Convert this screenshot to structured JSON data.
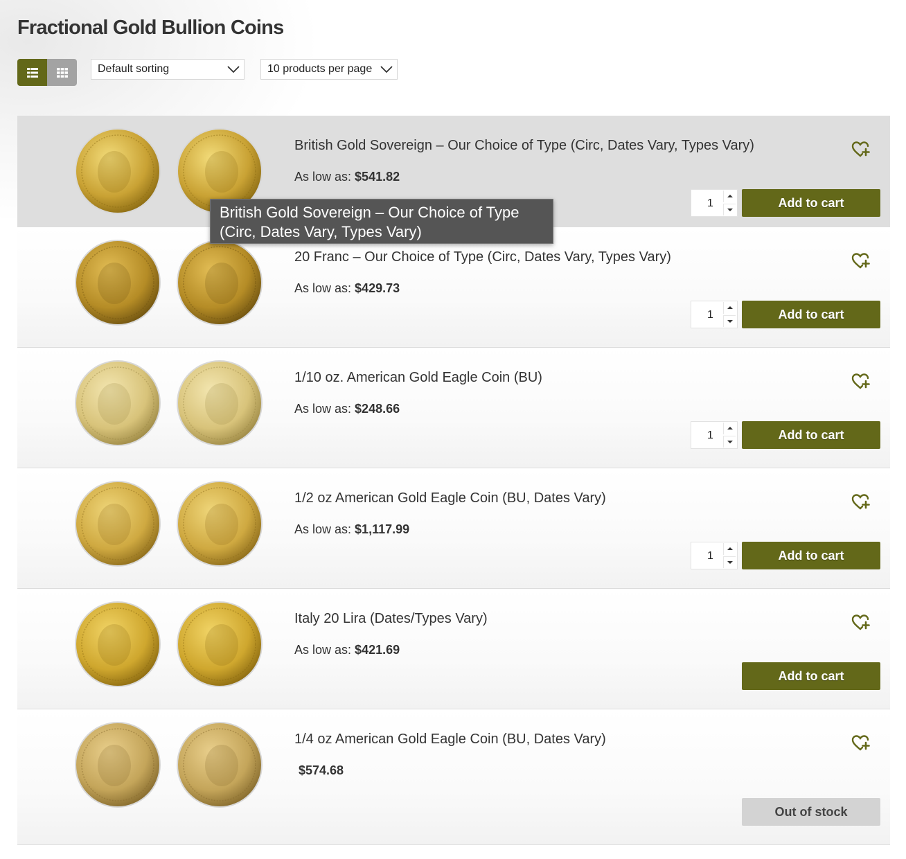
{
  "page": {
    "title": "Fractional Gold Bullion Coins"
  },
  "toolbar": {
    "view_list_icon": "list-view-icon",
    "view_grid_icon": "grid-view-icon",
    "sorting": "Default sorting",
    "per_page": "10 products per page"
  },
  "colors": {
    "accent": "#636819",
    "inactive_toggle": "#a3a3a3",
    "out_of_stock": "#d3d3d3",
    "tooltip_bg": "#555555"
  },
  "tooltip": {
    "text": "British Gold Sovereign – Our Choice of Type (Circ, Dates Vary, Types Vary)"
  },
  "products": [
    {
      "name": "British Gold Sovereign – Our Choice of Type (Circ, Dates Vary, Types Vary)",
      "price_label": "As low as:",
      "price": "$541.82",
      "qty": "1",
      "button": "Add to cart"
    },
    {
      "name": "20 Franc – Our Choice of Type (Circ, Dates Vary, Types Vary)",
      "price_label": "As low as:",
      "price": "$429.73",
      "qty": "1",
      "button": "Add to cart"
    },
    {
      "name": "1/10 oz. American Gold Eagle Coin (BU)",
      "price_label": "As low as:",
      "price": "$248.66",
      "qty": "1",
      "button": "Add to cart"
    },
    {
      "name": "1/2 oz American Gold Eagle Coin (BU, Dates Vary)",
      "price_label": "As low as:",
      "price": "$1,117.99",
      "qty": "1",
      "button": "Add to cart"
    },
    {
      "name": "Italy 20 Lira (Dates/Types Vary)",
      "price_label": "As low as:",
      "price": "$421.69",
      "button": "Add to cart"
    },
    {
      "name": "1/4 oz American Gold Eagle Coin (BU, Dates Vary)",
      "price": "$574.68",
      "button": "Out of stock"
    }
  ]
}
